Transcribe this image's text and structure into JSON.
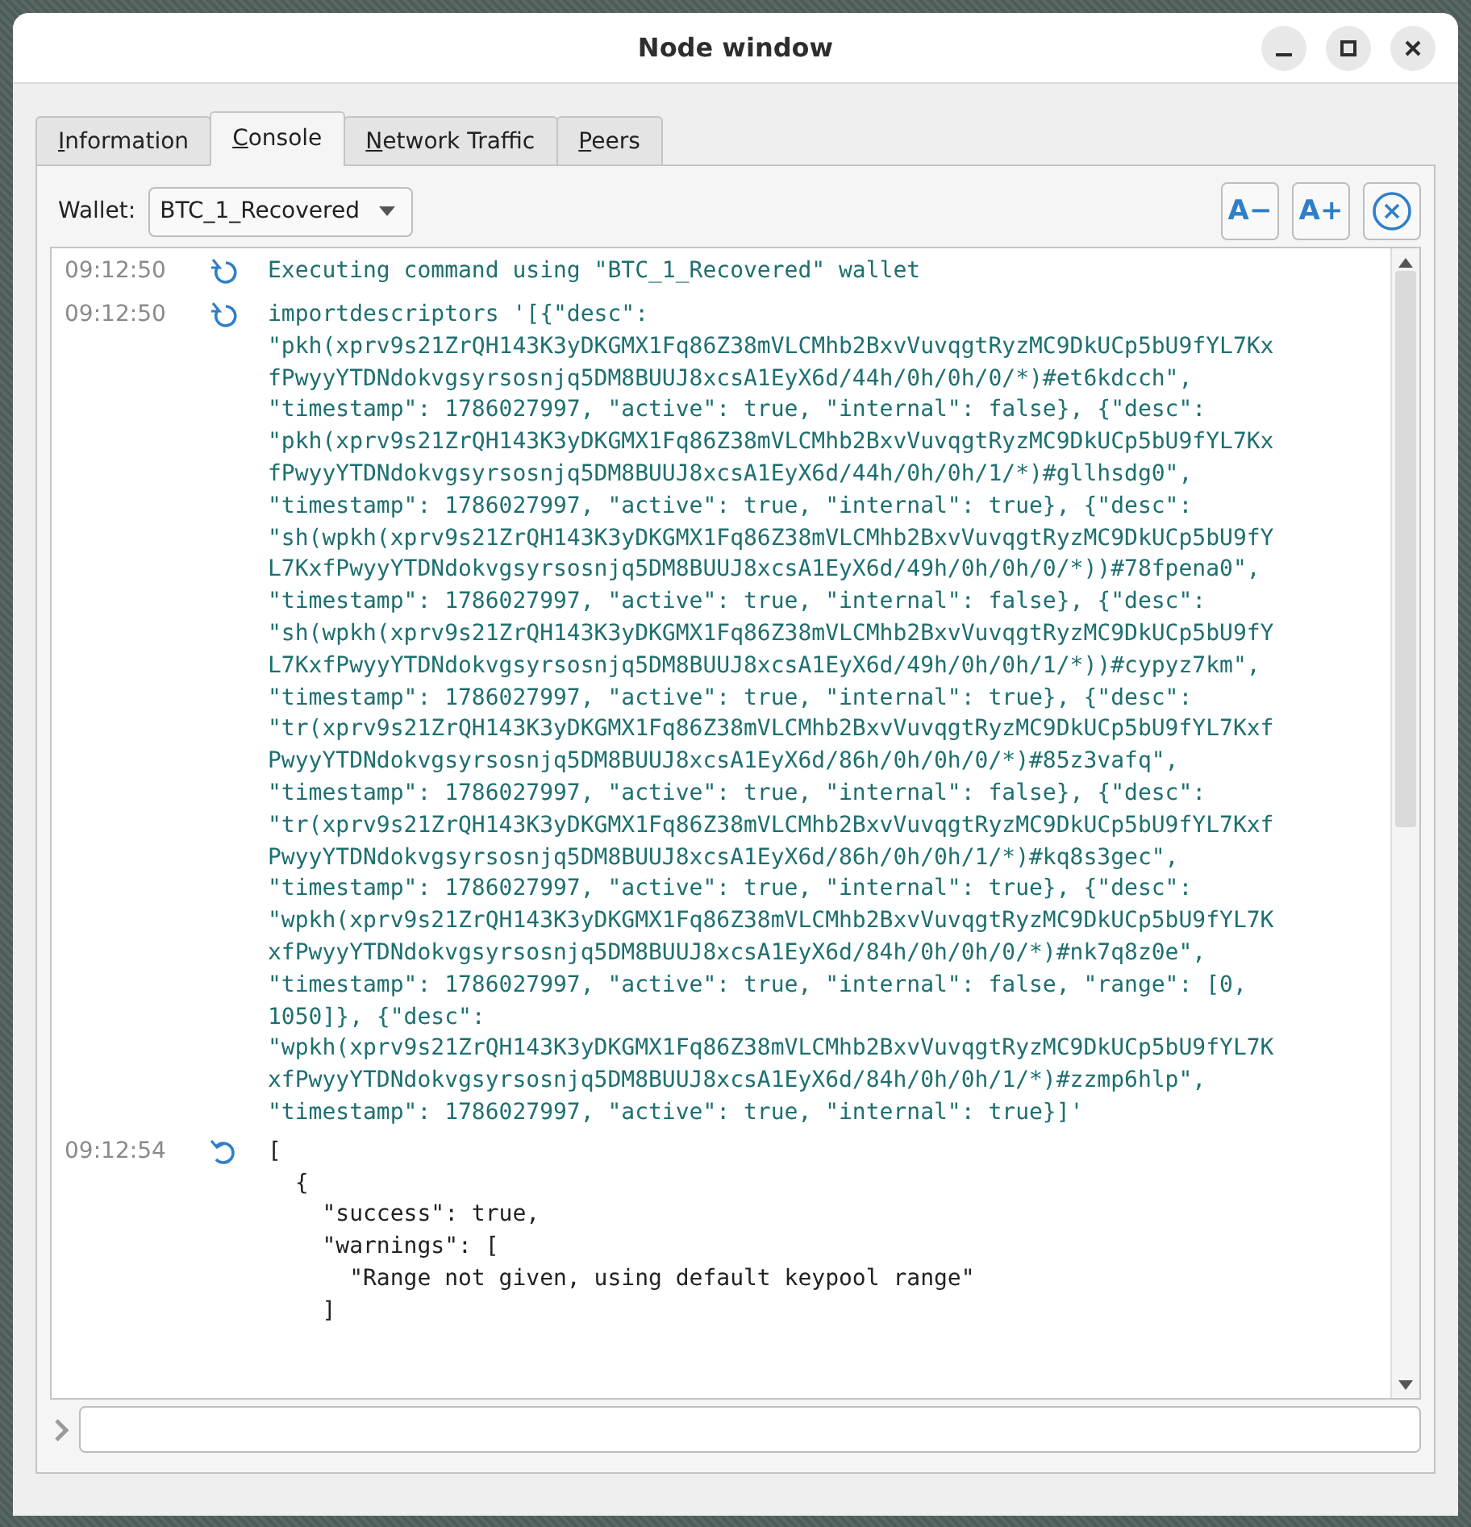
{
  "window": {
    "title": "Node window"
  },
  "tabs": [
    {
      "label": "Information",
      "selected": false
    },
    {
      "label": "Console",
      "selected": true
    },
    {
      "label": "Network Traffic",
      "selected": false
    },
    {
      "label": "Peers",
      "selected": false
    }
  ],
  "wallet": {
    "label": "Wallet:",
    "value": "BTC_1_Recovered"
  },
  "font_buttons": [
    "A−",
    "A+"
  ],
  "messages": [
    {
      "time": "09:12:50",
      "kind": "request",
      "lines": [
        "Executing command using \"BTC_1_Recovered\" wallet"
      ]
    },
    {
      "time": "09:12:50",
      "kind": "request",
      "lines": [
        "importdescriptors '[{\"desc\":",
        "\"pkh(xprv9s21ZrQH143K3yDKGMX1Fq86Z38mVLCMhb2BxvVuvqgtRyzMC9DkUCp5bU9fYL7Kx",
        "fPwyyYTDNdokvgsyrsosnjq5DM8BUUJ8xcsA1EyX6d/44h/0h/0h/0/*)#et6kdcch\",",
        "\"timestamp\": 1786027997, \"active\": true, \"internal\": false}, {\"desc\":",
        "\"pkh(xprv9s21ZrQH143K3yDKGMX1Fq86Z38mVLCMhb2BxvVuvqgtRyzMC9DkUCp5bU9fYL7Kx",
        "fPwyyYTDNdokvgsyrsosnjq5DM8BUUJ8xcsA1EyX6d/44h/0h/0h/1/*)#gllhsdg0\",",
        "\"timestamp\": 1786027997, \"active\": true, \"internal\": true}, {\"desc\":",
        "\"sh(wpkh(xprv9s21ZrQH143K3yDKGMX1Fq86Z38mVLCMhb2BxvVuvqgtRyzMC9DkUCp5bU9fY",
        "L7KxfPwyyYTDNdokvgsyrsosnjq5DM8BUUJ8xcsA1EyX6d/49h/0h/0h/0/*))#78fpena0\",",
        "\"timestamp\": 1786027997, \"active\": true, \"internal\": false}, {\"desc\":",
        "\"sh(wpkh(xprv9s21ZrQH143K3yDKGMX1Fq86Z38mVLCMhb2BxvVuvqgtRyzMC9DkUCp5bU9fY",
        "L7KxfPwyyYTDNdokvgsyrsosnjq5DM8BUUJ8xcsA1EyX6d/49h/0h/0h/1/*))#cypyz7km\",",
        "\"timestamp\": 1786027997, \"active\": true, \"internal\": true}, {\"desc\":",
        "\"tr(xprv9s21ZrQH143K3yDKGMX1Fq86Z38mVLCMhb2BxvVuvqgtRyzMC9DkUCp5bU9fYL7Kxf",
        "PwyyYTDNdokvgsyrsosnjq5DM8BUUJ8xcsA1EyX6d/86h/0h/0h/0/*)#85z3vafq\",",
        "\"timestamp\": 1786027997, \"active\": true, \"internal\": false}, {\"desc\":",
        "\"tr(xprv9s21ZrQH143K3yDKGMX1Fq86Z38mVLCMhb2BxvVuvqgtRyzMC9DkUCp5bU9fYL7Kxf",
        "PwyyYTDNdokvgsyrsosnjq5DM8BUUJ8xcsA1EyX6d/86h/0h/0h/1/*)#kq8s3gec\",",
        "\"timestamp\": 1786027997, \"active\": true, \"internal\": true}, {\"desc\":",
        "\"wpkh(xprv9s21ZrQH143K3yDKGMX1Fq86Z38mVLCMhb2BxvVuvqgtRyzMC9DkUCp5bU9fYL7K",
        "xfPwyyYTDNdokvgsyrsosnjq5DM8BUUJ8xcsA1EyX6d/84h/0h/0h/0/*)#nk7q8z0e\",",
        "\"timestamp\": 1786027997, \"active\": true, \"internal\": false, \"range\": [0,",
        "1050]}, {\"desc\":",
        "\"wpkh(xprv9s21ZrQH143K3yDKGMX1Fq86Z38mVLCMhb2BxvVuvqgtRyzMC9DkUCp5bU9fYL7K",
        "xfPwyyYTDNdokvgsyrsosnjq5DM8BUUJ8xcsA1EyX6d/84h/0h/0h/1/*)#zzmp6hlp\",",
        "\"timestamp\": 1786027997, \"active\": true, \"internal\": true}]'"
      ]
    },
    {
      "time": "09:12:54",
      "kind": "reply",
      "lines": [
        "[",
        "  {",
        "    \"success\": true,",
        "    \"warnings\": [",
        "      \"Range not given, using default keypool range\"",
        "    ]"
      ]
    }
  ]
}
